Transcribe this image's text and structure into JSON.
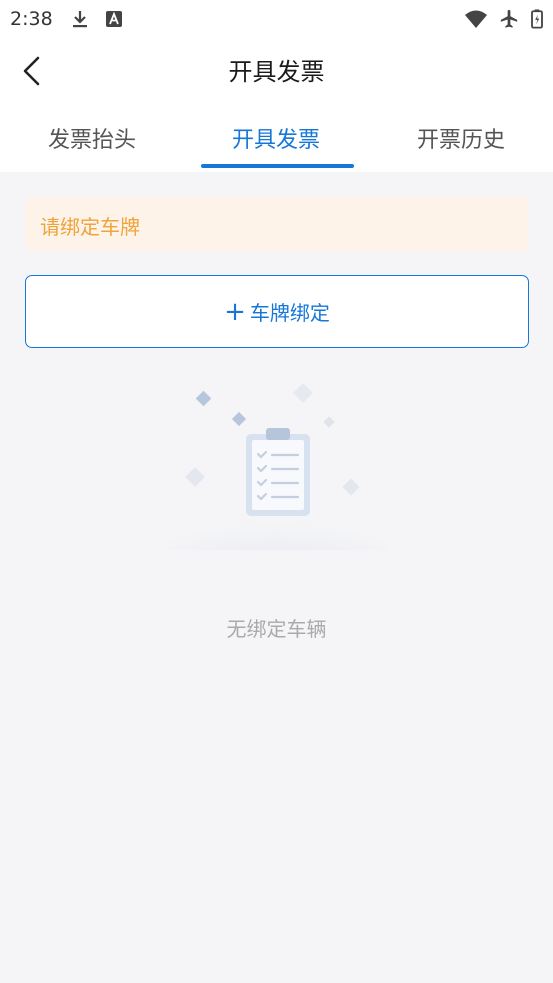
{
  "status_bar": {
    "time": "2:38",
    "icons": [
      "download-icon",
      "font-a-icon",
      "wifi-icon",
      "airplane-icon",
      "battery-icon"
    ]
  },
  "header": {
    "title": "开具发票",
    "back_icon": "chevron-left-icon"
  },
  "tabs": [
    {
      "label": "发票抬头",
      "active": false
    },
    {
      "label": "开具发票",
      "active": true
    },
    {
      "label": "开票历史",
      "active": false
    }
  ],
  "notice": {
    "text": "请绑定车牌"
  },
  "bind_button": {
    "plus": "+",
    "label": "车牌绑定"
  },
  "empty_state": {
    "text": "无绑定车辆",
    "icon": "clipboard-checklist-icon"
  },
  "colors": {
    "accent": "#1677d9",
    "notice_bg": "#fdf3e8",
    "notice_text": "#f0a33a",
    "page_bg": "#f5f5f7"
  }
}
